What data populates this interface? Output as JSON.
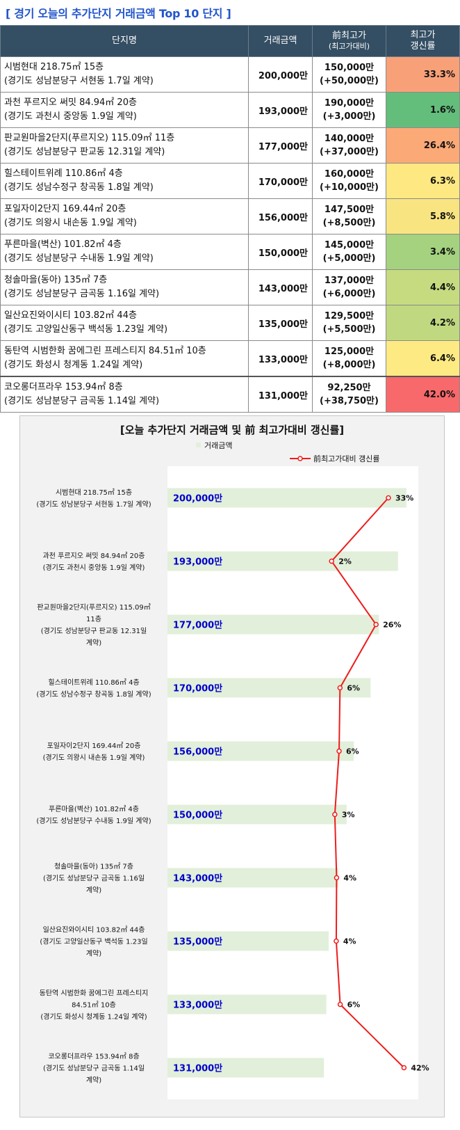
{
  "header": {
    "title": "[ 경기 오늘의 추가단지 거래금액 Top 10 단지 ]"
  },
  "table": {
    "columns": {
      "name": "단지명",
      "amount": "거래금액",
      "prev_1": "前최고가",
      "prev_2": "(최고가대비)",
      "rate_1": "최고가",
      "rate_2": "갱신률"
    },
    "rows": [
      {
        "line1": "시범현대 218.75㎡ 15층",
        "line2": "(경기도 성남분당구 서현동 1.7일 계약)",
        "amount": "200,000만",
        "prev": "150,000만",
        "diff": "(+50,000만)",
        "rate": "33.3%",
        "color": "#f8a178"
      },
      {
        "line1": "과천 푸르지오 써밋 84.94㎡ 20층",
        "line2": "(경기도 과천시 중앙동 1.9일 계약)",
        "amount": "193,000만",
        "prev": "190,000만",
        "diff": "(+3,000만)",
        "rate": "1.6%",
        "color": "#63be7b"
      },
      {
        "line1": "판교원마을2단지(푸르지오) 115.09㎡ 11층",
        "line2": "(경기도 성남분당구 판교동 12.31일 계약)",
        "amount": "177,000만",
        "prev": "140,000만",
        "diff": "(+37,000만)",
        "rate": "26.4%",
        "color": "#fba977"
      },
      {
        "line1": "힐스테이트위례 110.86㎡ 4층",
        "line2": "(경기도 성남수정구 창곡동 1.8일 계약)",
        "amount": "170,000만",
        "prev": "160,000만",
        "diff": "(+10,000만)",
        "rate": "6.3%",
        "color": "#fde882"
      },
      {
        "line1": "포일자이2단지 169.44㎡ 20층",
        "line2": "(경기도 의왕시 내손동 1.9일 계약)",
        "amount": "156,000만",
        "prev": "147,500만",
        "diff": "(+8,500만)",
        "rate": "5.8%",
        "color": "#f8e581"
      },
      {
        "line1": "푸른마을(벽산) 101.82㎡ 4층",
        "line2": "(경기도 성남분당구 수내동 1.9일 계약)",
        "amount": "150,000만",
        "prev": "145,000만",
        "diff": "(+5,000만)",
        "rate": "3.4%",
        "color": "#a4d27f"
      },
      {
        "line1": "청솔마을(동아) 135㎡ 7층",
        "line2": "(경기도 성남분당구 금곡동 1.16일 계약)",
        "amount": "143,000만",
        "prev": "137,000만",
        "diff": "(+6,000만)",
        "rate": "4.4%",
        "color": "#c6db80"
      },
      {
        "line1": "일산요진와이시티 103.82㎡ 44층",
        "line2": "(경기도 고양일산동구 백석동 1.23일 계약)",
        "amount": "135,000만",
        "prev": "129,500만",
        "diff": "(+5,500만)",
        "rate": "4.2%",
        "color": "#c0d980"
      },
      {
        "line1": "동탄역 시범한화 꿈에그린 프레스티지 84.51㎡ 10층",
        "line2": "(경기도 화성시 청계동 1.24일 계약)",
        "amount": "133,000만",
        "prev": "125,000만",
        "diff": "(+8,000만)",
        "rate": "6.4%",
        "color": "#feea83"
      },
      {
        "line1": "코오롱더프라우 153.94㎡ 8층",
        "line2": "(경기도 성남분당구 금곡동 1.14일 계약)",
        "amount": "131,000만",
        "prev": "92,250만",
        "diff": "(+38,750만)",
        "rate": "42.0%",
        "color": "#f8696b"
      }
    ]
  },
  "chart_data": {
    "type": "bar",
    "orientation": "horizontal",
    "title": "[오늘 추가단지 거래금액 및 前 최고가대비 갱신률]",
    "legend_position": "top",
    "grid": false,
    "categories": [
      [
        "시범현대 218.75㎡ 15층",
        "(경기도 성남분당구 서현동 1.7일 계약)"
      ],
      [
        "과천 푸르지오 써밋 84.94㎡ 20층",
        "(경기도 과천시 중앙동 1.9일 계약)"
      ],
      [
        "판교원마을2단지(푸르지오) 115.09㎡",
        "11층",
        "(경기도 성남분당구 판교동 12.31일",
        "계약)"
      ],
      [
        "힐스테이트위례 110.86㎡ 4층",
        "(경기도 성남수정구 창곡동 1.8일 계약)"
      ],
      [
        "포일자이2단지 169.44㎡ 20층",
        "(경기도 의왕시 내손동 1.9일 계약)"
      ],
      [
        "푸른마을(벽산) 101.82㎡ 4층",
        "(경기도 성남분당구 수내동 1.9일 계약)"
      ],
      [
        "청솔마을(동아) 135㎡ 7층",
        "(경기도 성남분당구 금곡동 1.16일",
        "계약)"
      ],
      [
        "일산요진와이시티 103.82㎡ 44층",
        "(경기도 고양일산동구 백석동 1.23일",
        "계약)"
      ],
      [
        "동탄역 시범한화 꿈에그린 프레스티지",
        "84.51㎡ 10층",
        "(경기도 화성시 청계동 1.24일 계약)"
      ],
      [
        "코오롱더프라우 153.94㎡ 8층",
        "(경기도 성남분당구 금곡동 1.14일",
        "계약)"
      ]
    ],
    "series": [
      {
        "name": "거래금액",
        "kind": "bar",
        "color": "#e2efda",
        "label_color": "#0000cc",
        "values": [
          200000,
          193000,
          177000,
          170000,
          156000,
          150000,
          143000,
          135000,
          133000,
          131000
        ],
        "labels": [
          "200,000만",
          "193,000만",
          "177,000만",
          "170,000만",
          "156,000만",
          "150,000만",
          "143,000만",
          "135,000만",
          "133,000만",
          "131,000만"
        ]
      },
      {
        "name": "前최고가대비 갱신률",
        "kind": "line",
        "color": "#ee1c1c",
        "values": [
          33.3,
          1.6,
          26.4,
          6.3,
          5.8,
          3.4,
          4.4,
          4.2,
          6.4,
          42.0
        ],
        "labels": [
          "33%",
          "2%",
          "26%",
          "6%",
          "6%",
          "3%",
          "4%",
          "4%",
          "6%",
          "42%"
        ]
      }
    ],
    "xlim_bar": [
      0,
      210000
    ],
    "xlim_line": [
      -90,
      50
    ]
  }
}
